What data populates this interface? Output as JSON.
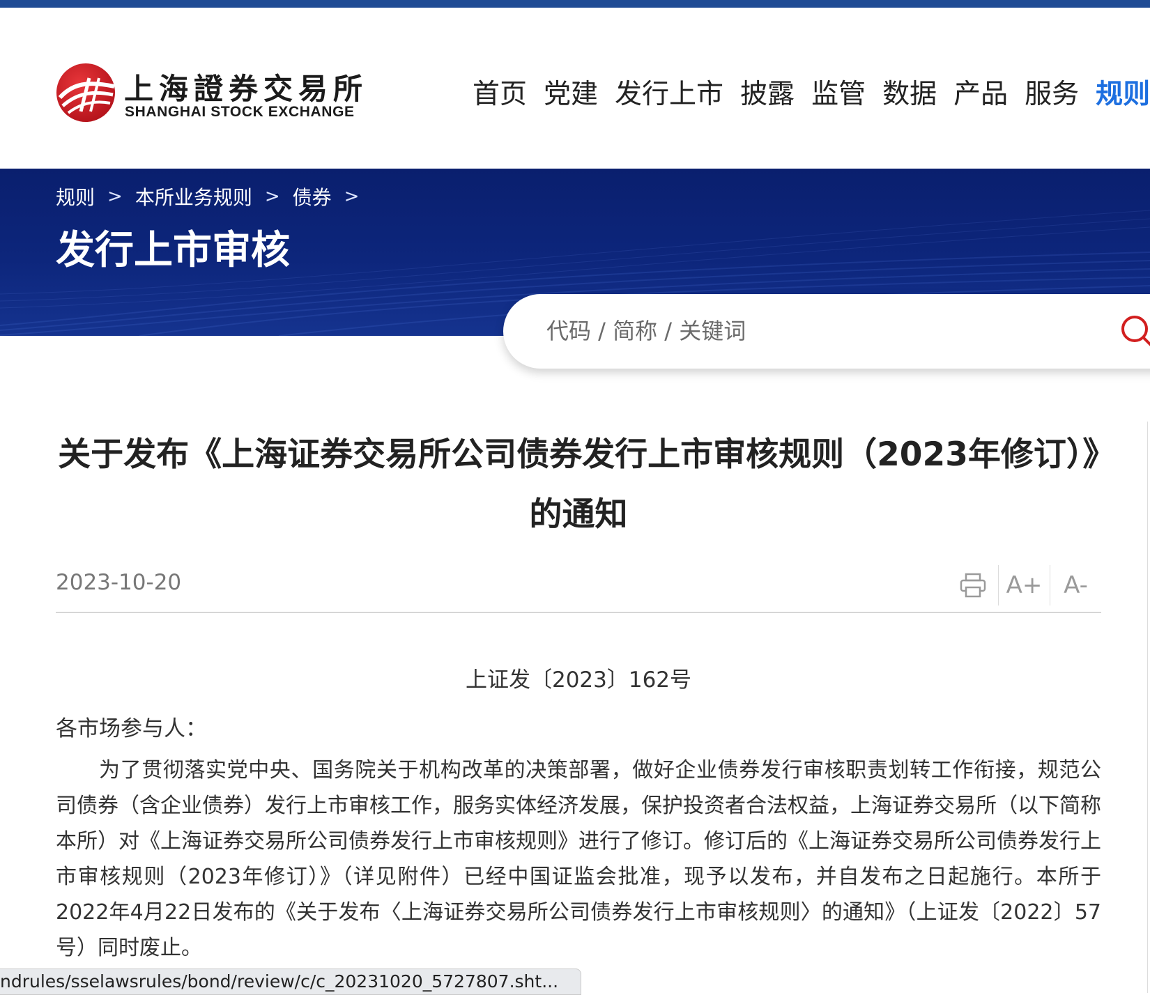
{
  "header": {
    "logo_cn": "上海證券交易所",
    "logo_en": "SHANGHAI STOCK EXCHANGE",
    "nav": [
      {
        "label": "首页"
      },
      {
        "label": "党建"
      },
      {
        "label": "发行上市"
      },
      {
        "label": "披露"
      },
      {
        "label": "监管"
      },
      {
        "label": "数据"
      },
      {
        "label": "产品"
      },
      {
        "label": "服务"
      },
      {
        "label": "规则"
      }
    ],
    "active_nav": "规则"
  },
  "banner": {
    "breadcrumb": [
      "规则",
      "本所业务规则",
      "债券"
    ],
    "breadcrumb_sep": ">",
    "page_title": "发行上市审核"
  },
  "search": {
    "placeholder": "代码 / 简称 / 关键词"
  },
  "article": {
    "title": "关于发布《上海证券交易所公司债券发行上市审核规则（2023年修订）》的通知",
    "date": "2023-10-20",
    "tools": {
      "font_increase": "A+",
      "font_decrease": "A-"
    },
    "doc_number": "上证发〔2023〕162号",
    "salutation": "各市场参与人：",
    "body": "为了贯彻落实党中央、国务院关于机构改革的决策部署，做好企业债券发行审核职责划转工作衔接，规范公司债券（含企业债券）发行上市审核工作，服务实体经济发展，保护投资者合法权益，上海证券交易所（以下简称本所）对《上海证券交易所公司债券发行上市审核规则》进行了修订。修订后的《上海证券交易所公司债券发行上市审核规则（2023年修订）》（详见附件）已经中国证监会批准，现予以发布，并自发布之日起施行。本所于2022年4月22日发布的《关于发布〈上海证券交易所公司债券发行上市审核规则〉的通知》（上证发〔2022〕57号）同时废止。"
  },
  "status_bar": {
    "url": "ndrules/sselawsrules/bond/review/c/c_20231020_5727807.sht..."
  },
  "colors": {
    "top_bar": "#1f4b94",
    "banner": "#0d267c",
    "active_nav": "#1d6fe0",
    "logo_red": "#c8161d",
    "search_icon": "#d21f1f"
  }
}
